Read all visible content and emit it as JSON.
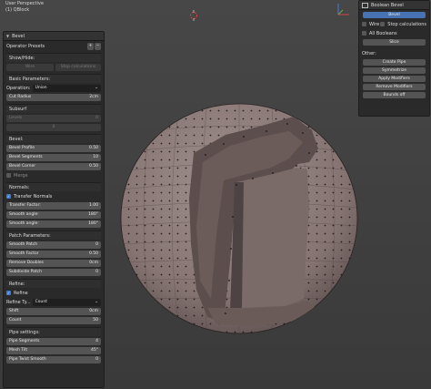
{
  "viewport": {
    "title": "User Perspective",
    "subtitle": "(1) QBlock"
  },
  "left_panel": {
    "header": "Bevel",
    "operator_presets": "Operator Presets",
    "preset_add": "+",
    "preset_remove": "−",
    "show_hide": {
      "title": "Show/Hide:",
      "wire": "Wire",
      "stop_calculations": "Stop calculations"
    },
    "basic": {
      "title": "Basic Parameters:",
      "operation_label": "Operation:",
      "operation_value": "Union",
      "cut_radius_label": "Cut Radius",
      "cut_radius_value": "2cm"
    },
    "subsurf": {
      "title": "Subsurf",
      "levels_label": "Levels",
      "levels_value": "0",
      "value2": "0"
    },
    "bevel": {
      "title": "Bevel:",
      "profile_label": "Bevel Profile",
      "profile_value": "0.50",
      "segments_label": "Bevel Segments",
      "segments_value": "10",
      "corner_label": "Bevel Corner",
      "corner_value": "0.50",
      "merge_label": "Merge"
    },
    "normals": {
      "title": "Normals:",
      "transfer_label": "Transfer Normals",
      "factor_label": "Transfer Factor:",
      "factor_value": "1.00",
      "smooth1_label": "Smooth angle:",
      "smooth1_value": "180°",
      "smooth2_label": "Smooth angle:",
      "smooth2_value": "180°"
    },
    "patch": {
      "title": "Patch Parameters:",
      "smooth_patch_label": "Smooth Patch",
      "smooth_patch_value": "0",
      "smooth_factor_label": "Smooth Factor",
      "smooth_factor_value": "0.50",
      "remove_doubles_label": "Remove Doubles",
      "remove_doubles_value": "0cm",
      "subdivide_label": "Subdivide Patch",
      "subdivide_value": "0"
    },
    "refine": {
      "title": "Refine:",
      "refine_label": "Refine",
      "refine_type_label": "Refine Ty...",
      "refine_type_value": "Count",
      "shift_label": "Shift",
      "shift_value": "0cm",
      "count_label": "Count",
      "count_value": "50"
    },
    "pipe": {
      "title": "Pipe settings:",
      "segments_label": "Pipe Segments",
      "segments_value": "4",
      "mesh_tilt_label": "Mesh Tilt",
      "mesh_tilt_value": "45°",
      "twist_label": "Pipe Twist Smooth",
      "twist_value": "0"
    }
  },
  "right_panel": {
    "header": "Boolean Bevel",
    "bevel_button": "Bevel",
    "wire_label": "Wire",
    "stop_calc_label": "Stop calculations",
    "all_booleans_label": "All Booleans",
    "slice_button": "Slice",
    "other_label": "Other:",
    "create_pipe": "Create Pipe",
    "symmetrize": "Symmetrize",
    "apply_modifiers": "Apply Modifiers",
    "remove_modifiers": "Remove Modifiers",
    "bounds_off": "Bounds off"
  },
  "colors": {
    "sphere": "#8a7a78",
    "accent": "#4772b3",
    "panel_bg": "#2a2a2a"
  }
}
